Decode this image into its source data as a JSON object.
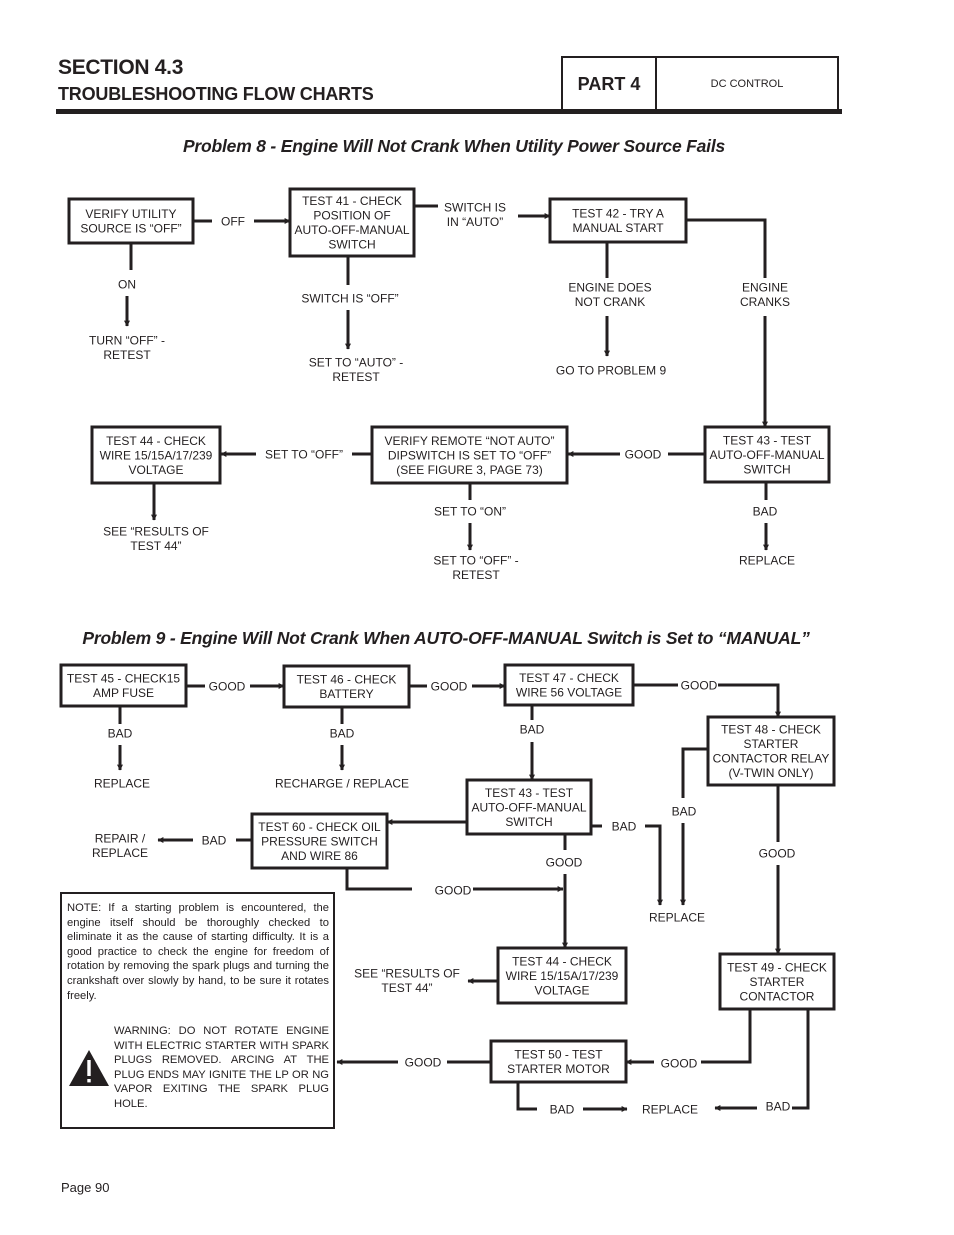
{
  "header": {
    "section": "SECTION 4.3",
    "subtitle": "TROUBLESHOOTING FLOW CHARTS",
    "part": "PART 4",
    "topic": "DC CONTROL"
  },
  "problem8": {
    "title": "Problem 8 - Engine Will Not Crank When Utility Power Source Fails",
    "boxes": {
      "verify_utility": [
        "VERIFY UTILITY",
        "SOURCE IS “OFF”"
      ],
      "test41": [
        "TEST 41 - CHECK",
        "POSITION OF",
        "AUTO-OFF-MANUAL",
        "SWITCH"
      ],
      "test42": [
        "TEST 42 - TRY A",
        "MANUAL START"
      ],
      "test43": [
        "TEST 43 - TEST",
        "AUTO-OFF-MANUAL",
        "SWITCH"
      ],
      "verify_remote": [
        "VERIFY REMOTE “NOT AUTO”",
        "DIPSWITCH IS SET TO “OFF”",
        "(SEE FIGURE 3, PAGE  73)"
      ],
      "test44": [
        "TEST 44 - CHECK",
        "WIRE 15/15A/17/239",
        "VOLTAGE"
      ]
    },
    "labels": {
      "off": "OFF",
      "on": "ON",
      "turn_off_retest": [
        "TURN “OFF” -",
        "RETEST"
      ],
      "switch_in_auto": [
        "SWITCH IS",
        "IN “AUTO”"
      ],
      "switch_is_off": "SWITCH IS “OFF”",
      "set_to_auto_retest": [
        "SET TO “AUTO” -",
        "RETEST"
      ],
      "engine_does_not_crank": [
        "ENGINE DOES",
        "NOT CRANK"
      ],
      "go_to_problem_9": "GO TO PROBLEM 9",
      "engine_cranks": [
        "ENGINE",
        "CRANKS"
      ],
      "good": "GOOD",
      "bad": "BAD",
      "replace": "REPLACE",
      "set_to_off": "SET TO “OFF”",
      "set_to_on": "SET TO “ON”",
      "set_to_off_retest": [
        "SET TO “OFF” -",
        "RETEST"
      ],
      "see_results_44": [
        "SEE “RESULTS OF",
        "TEST 44”"
      ]
    }
  },
  "problem9": {
    "title": "Problem 9 - Engine Will Not Crank When AUTO-OFF-MANUAL Switch is Set to “MANUAL”",
    "boxes": {
      "test45": [
        "TEST 45 - CHECK15",
        "AMP FUSE"
      ],
      "test46": [
        "TEST 46 - CHECK",
        "BATTERY"
      ],
      "test47": [
        "TEST 47 - CHECK",
        "WIRE 56 VOLTAGE"
      ],
      "test48": [
        "TEST 48 - CHECK",
        "STARTER",
        "CONTACTOR RELAY",
        "(V-TWIN ONLY)"
      ],
      "test43": [
        "TEST 43 - TEST",
        "AUTO-OFF-MANUAL",
        "SWITCH"
      ],
      "test60": [
        "TEST 60 - CHECK OIL",
        "PRESSURE SWITCH",
        "AND WIRE 86"
      ],
      "test44": [
        "TEST 44 - CHECK",
        "WIRE 15/15A/17/239",
        "VOLTAGE"
      ],
      "test49": [
        "TEST 49 - CHECK",
        "STARTER",
        "CONTACTOR"
      ],
      "test50": [
        "TEST 50 - TEST",
        "STARTER MOTOR"
      ]
    },
    "labels": {
      "good": "GOOD",
      "bad": "BAD",
      "replace": "REPLACE",
      "recharge_replace": "RECHARGE / REPLACE",
      "repair_replace": [
        "REPAIR /",
        "REPLACE"
      ],
      "see_results_44": [
        "SEE “RESULTS OF",
        "TEST 44”"
      ]
    },
    "note": "NOTE: If a starting problem is encountered, the engine itself should be thoroughly checked to eliminate it as the cause of starting difficulty. It is a good practice to check the engine for freedom of rotation by removing the spark plugs and turning the crankshaft over slowly by hand, to be sure it rotates freely.",
    "warning": "WARNING: DO NOT ROTATE ENGINE WITH ELECTRIC STARTER WITH SPARK PLUGS REMOVED. ARCING AT THE PLUG ENDS MAY IGNITE THE LP OR NG VAPOR EXITING THE SPARK PLUG HOLE."
  },
  "footer": {
    "page": "Page 90"
  }
}
